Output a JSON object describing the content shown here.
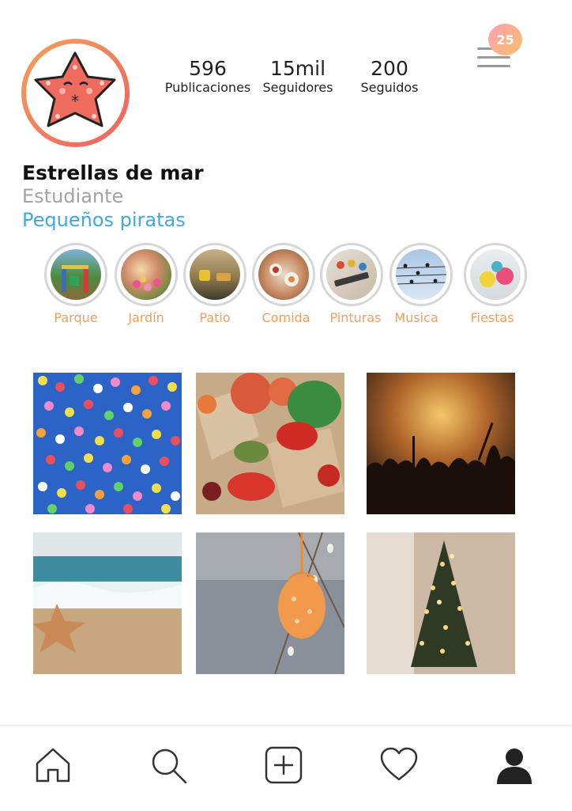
{
  "notifications": {
    "count": "25"
  },
  "stats": [
    {
      "value": "596",
      "label": "Publicaciones"
    },
    {
      "value": "15mil",
      "label": "Seguidores"
    },
    {
      "value": "200",
      "label": "Seguidos"
    }
  ],
  "profile": {
    "name": "Estrellas de mar",
    "role": "Estudiante",
    "link": "Pequeños piratas"
  },
  "highlights": [
    {
      "label": "Parque"
    },
    {
      "label": "Jardín"
    },
    {
      "label": "Patio"
    },
    {
      "label": "Comida"
    },
    {
      "label": "Pinturas"
    },
    {
      "label": "Musica"
    },
    {
      "label": "Fiestas"
    }
  ],
  "posts": [
    {
      "subject": "balloons"
    },
    {
      "subject": "vegetables"
    },
    {
      "subject": "concert"
    },
    {
      "subject": "beach-starfish"
    },
    {
      "subject": "easter-egg"
    },
    {
      "subject": "christmas-tree"
    }
  ],
  "nav": {
    "items": [
      "home-icon",
      "search-icon",
      "add-icon",
      "heart-icon",
      "profile-icon"
    ]
  },
  "colors": {
    "accent_orange": "#f0a05a",
    "link_blue": "#3fa9dd",
    "muted_gray": "#a3a3a3",
    "starfish": "#ee6b5d"
  }
}
